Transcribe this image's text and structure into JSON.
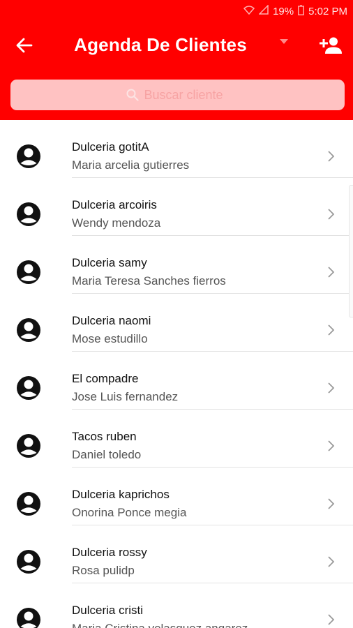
{
  "status_bar": {
    "battery": "19%",
    "time": "5:02 PM"
  },
  "header": {
    "title": "Agenda De Clientes",
    "back_icon": "arrow-left-icon",
    "add_icon": "person-add-icon",
    "accent_color": "#ff0000"
  },
  "search": {
    "placeholder": "Buscar cliente",
    "icon": "search-icon"
  },
  "clients": [
    {
      "business": "Dulceria gotitA",
      "contact": "Maria arcelia gutierres"
    },
    {
      "business": "Dulceria arcoiris",
      "contact": "Wendy mendoza"
    },
    {
      "business": "Dulceria samy",
      "contact": "Maria Teresa Sanches fierros"
    },
    {
      "business": "Dulceria naomi",
      "contact": "Mose estudillo"
    },
    {
      "business": "El compadre",
      "contact": "Jose Luis fernandez"
    },
    {
      "business": "Tacos ruben",
      "contact": "Daniel toledo"
    },
    {
      "business": "Dulceria kaprichos",
      "contact": "Onorina Ponce megia"
    },
    {
      "business": "Dulceria rossy",
      "contact": "Rosa pulidp"
    },
    {
      "business": "Dulceria cristi",
      "contact": "Maria Cristina velasquez angarez"
    }
  ]
}
